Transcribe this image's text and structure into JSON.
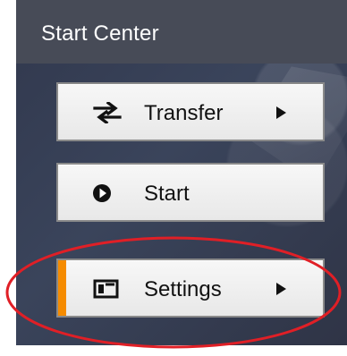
{
  "header": {
    "title": "Start Center"
  },
  "menu": {
    "items": [
      {
        "label": "Transfer",
        "icon": "transfer-arrows-icon",
        "has_submenu": true
      },
      {
        "label": "Start",
        "icon": "play-circle-icon",
        "has_submenu": false
      },
      {
        "label": "Settings",
        "icon": "settings-window-icon",
        "has_submenu": true,
        "selected": true
      }
    ]
  },
  "colors": {
    "header_bg": "#474b57",
    "panel_bg": "#3a445b",
    "button_bg": "#eeeeee",
    "button_border": "#8a8a8a",
    "selected_accent": "#f58b00",
    "annotation": "#e01f26"
  },
  "annotation": {
    "shape": "ellipse",
    "target": "Settings"
  }
}
